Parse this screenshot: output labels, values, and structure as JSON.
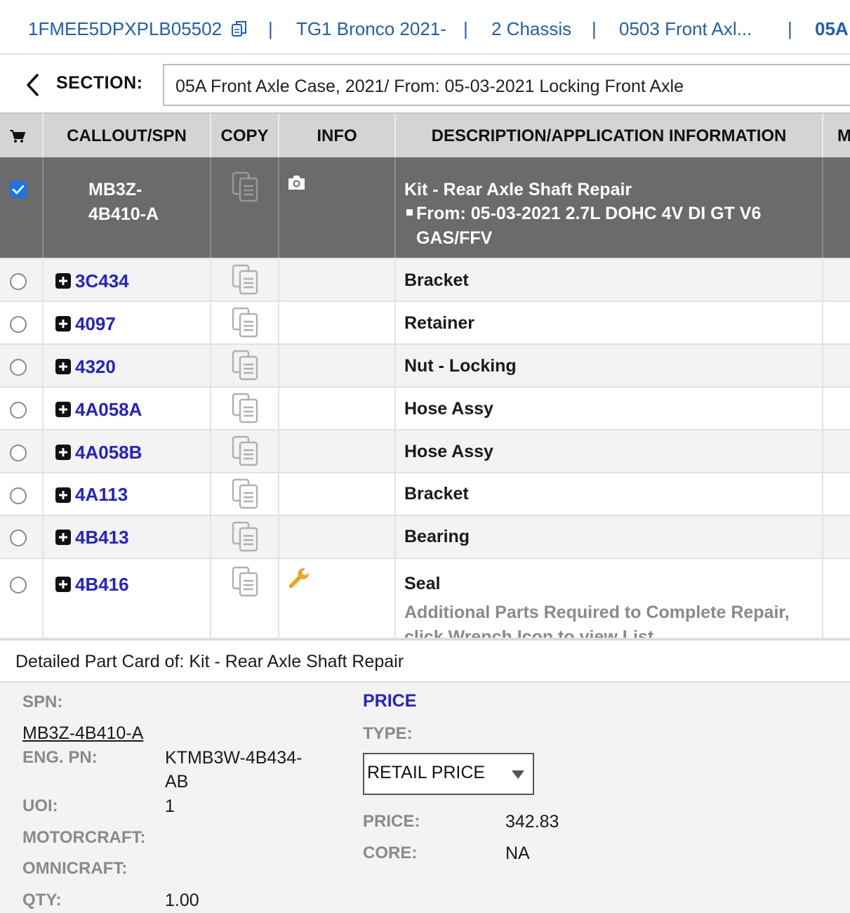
{
  "breadcrumb": {
    "vin": "1FMEE5DPXPLB05502",
    "model": "TG1 Bronco 2021-",
    "category": "2 Chassis",
    "group": "0503 Front Axl...",
    "partial": "05A",
    "separator": "|"
  },
  "section": {
    "label": "SECTION:",
    "value": "05A Front Axle Case, 2021/ From: 05-03-2021 Locking Front Axle"
  },
  "table": {
    "headers": {
      "callout": "CALLOUT/SPN",
      "copy": "COPY",
      "info": "INFO",
      "description": "DESCRIPTION/APPLICATION INFORMATION",
      "more": "M"
    },
    "selected_row": {
      "spn_line1": "MB3Z-",
      "spn_line2": "4B410-A",
      "desc_title": "Kit - Rear Axle Shaft Repair",
      "desc_line2": "From: 05-03-2021 2.7L DOHC 4V DI GT V6",
      "desc_line3": "GAS/FFV"
    },
    "rows": [
      {
        "spn": "3C434",
        "desc": "Bracket"
      },
      {
        "spn": "4097",
        "desc": "Retainer"
      },
      {
        "spn": "4320",
        "desc": "Nut - Locking"
      },
      {
        "spn": "4A058A",
        "desc": "Hose Assy"
      },
      {
        "spn": "4A058B",
        "desc": "Hose Assy"
      },
      {
        "spn": "4A113",
        "desc": "Bracket"
      },
      {
        "spn": "4B413",
        "desc": "Bearing"
      },
      {
        "spn": "4B416",
        "desc": "Seal",
        "note": "Additional Parts Required to Complete Repair,",
        "note2": "click Wrench Icon to view List"
      }
    ]
  },
  "detail_card": {
    "title": "Detailed Part Card of: Kit - Rear Axle Shaft Repair",
    "spn_label": "SPN:",
    "spn_value": "MB3Z-4B410-A",
    "eng_pn_label": "ENG. PN:",
    "eng_pn_value_1": "KTMB3W-4B434-",
    "eng_pn_value_2": "AB",
    "uoi_label": "UOI:",
    "uoi_value": "1",
    "motorcraft_label": "MOTORCRAFT:",
    "omnicraft_label": "OMNICRAFT:",
    "qty_label": "QTY:",
    "qty_value": "1.00",
    "price_heading": "PRICE",
    "type_label": "TYPE:",
    "type_selected": "RETAIL PRICE",
    "price_label": "PRICE:",
    "price_value": "342.83",
    "core_label": "CORE:",
    "core_value": "NA"
  },
  "colors": {
    "link": "#2222cc",
    "breadcrumb": "#1f5fb0",
    "selected_row": "#6b6b6b",
    "checkbox_on": "#1a73e8",
    "wrench": "#f0a020"
  },
  "icons": [
    "copy-icon",
    "chevron-left-icon",
    "cart-icon",
    "document-copy-icon",
    "camera-icon",
    "plus-box-icon",
    "wrench-icon",
    "caret-down-icon",
    "checkbox-checked-icon"
  ]
}
